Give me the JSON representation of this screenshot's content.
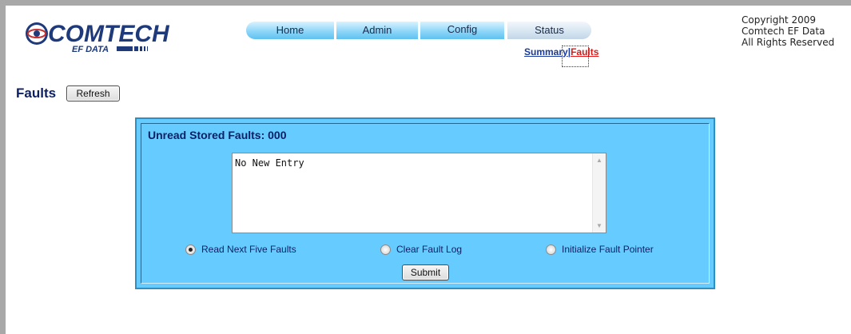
{
  "logo": {
    "brand": "COMTECH",
    "sub": "EF DATA"
  },
  "nav": {
    "tabs": [
      {
        "label": "Home"
      },
      {
        "label": "Admin"
      },
      {
        "label": "Config"
      },
      {
        "label": "Status"
      }
    ],
    "active_tab": "Status"
  },
  "subnav": {
    "summary": "Summary",
    "separator": "|",
    "faults": "Faults",
    "active": "Faults"
  },
  "copyright": {
    "line1": "Copyright 2009",
    "line2": "Comtech EF Data",
    "line3": "All Rights Reserved"
  },
  "page": {
    "title": "Faults",
    "refresh_label": "Refresh"
  },
  "panel": {
    "title": "Unread Stored Faults: 000",
    "log_text": "No New Entry",
    "options": [
      {
        "label": "Read Next Five Faults",
        "checked": true
      },
      {
        "label": "Clear Fault Log",
        "checked": false
      },
      {
        "label": "Initialize Fault Pointer",
        "checked": false
      }
    ],
    "submit_label": "Submit"
  },
  "colors": {
    "panel_bg": "#66ccff",
    "title_navy": "#0d1f63",
    "active_link": "#e01818",
    "link": "#1a3a9c"
  }
}
